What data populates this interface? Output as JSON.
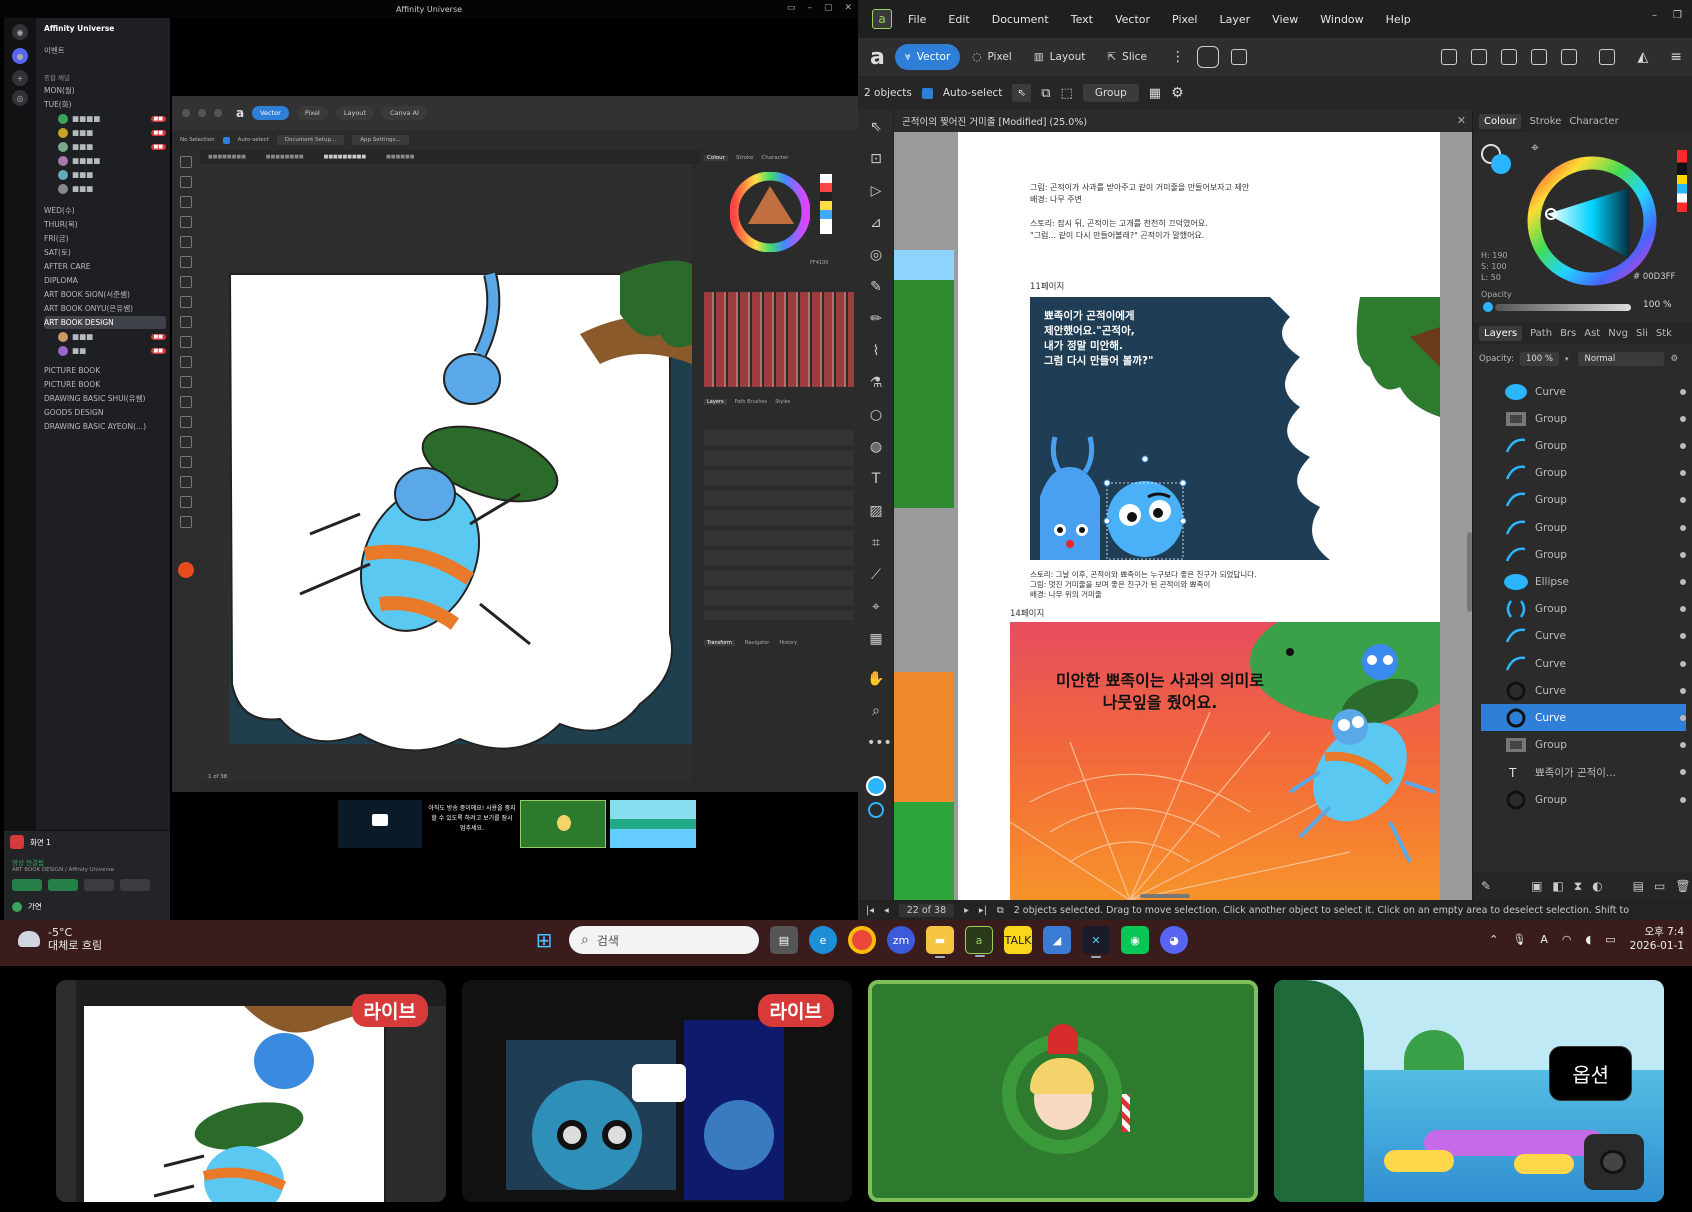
{
  "stream": {
    "title": "Affinity Universe",
    "discord": {
      "server_name": "Affinity Universe",
      "event_label": "이벤트",
      "category": "종합 채널",
      "channels": [
        {
          "label": "MON(월)"
        },
        {
          "label": "TUE(화)"
        },
        {
          "label": "WED(수)"
        },
        {
          "label": "THUR(목)"
        },
        {
          "label": "FRI(금)"
        },
        {
          "label": "SAT(토)"
        },
        {
          "label": "AFTER CARE"
        },
        {
          "label": "DIPLOMA"
        },
        {
          "label": "ART BOOK SION(서준쌤)"
        },
        {
          "label": "ART BOOK ONYU(은유쌤)"
        },
        {
          "label": "ART BOOK DESIGN"
        },
        {
          "label": "PICTURE BOOK"
        },
        {
          "label": "PICTURE BOOK"
        },
        {
          "label": "DRAWING BASIC SHUI(유쌤)"
        },
        {
          "label": "GOODS DESIGN"
        },
        {
          "label": "DRAWING BASIC AYEON(...)"
        }
      ],
      "voice_user": "화면 1",
      "voice_status": "영상 연결됨",
      "voice_channel": "ART BOOK DESIGN / Affinity Universe",
      "user_name": "가연"
    },
    "inner_app": {
      "tabs": [
        "Vector",
        "Pixel",
        "Layout",
        "Canva AI"
      ],
      "ctx": {
        "no_selection": "No Selection",
        "auto_select": "Auto-select",
        "doc_setup": "Document Setup...",
        "app_settings": "App Settings..."
      },
      "panel_tabs": [
        "Colour",
        "Stroke",
        "Character"
      ],
      "layers_tabs": [
        "Layers",
        "Path Brushes",
        "Styles"
      ],
      "transform_tabs": [
        "Transform",
        "Navigator",
        "History"
      ],
      "page_count": "1 of 38",
      "hex": "FF4100"
    },
    "stream_thumb_text": "아직도 방송 중이에요! 사용을 중지할 수 있도록 하려고 보기를 잠시 멈추세요."
  },
  "app": {
    "menu": [
      "File",
      "Edit",
      "Document",
      "Text",
      "Vector",
      "Pixel",
      "Layer",
      "View",
      "Window",
      "Help"
    ],
    "personas": [
      "Vector",
      "Pixel",
      "Layout",
      "Slice"
    ],
    "context": {
      "objects": "2 objects",
      "auto_select": "Auto-select",
      "group_btn": "Group"
    },
    "doc_title": "곤적이의 찢어진 거미줄 [Modified] (25.0%)",
    "doc_text": {
      "para1": "그림: 곤적이가 사과를 받아주고 같이 거미줄을 만들어보자고 제안",
      "para1b": "배경: 나무 주변",
      "para2": "스토리: 잠시 뒤, 곤적이는 고개를 천천히 끄덕였어요.",
      "para2b": "\"그럼... 같이 다시 만들어볼래?\" 곤적이가 말했어요.",
      "page11": "11페이지",
      "speech": [
        "뾰족이가 곤적이에게",
        "제안했어요.\"곤적아,",
        "내가 정말 미안해.",
        "그럼 다시 만들어 볼까?\""
      ],
      "para3": "스토리: 그날 이후, 곤적이와 뾰족이는 누구보다 좋은 친구가 되었답니다.",
      "para3b": "그림: 멋진 거미줄을 보며 좋은 친구가 된 곤적이와 뾰족이",
      "para3c": "배경: 나무 위의 거미줄",
      "page14": "14페이지",
      "big": [
        "미안한 뾰족이는 사과의 의미로",
        "나뭇잎을 줬어요."
      ]
    },
    "colour_panel": {
      "tabs": [
        "Colour",
        "Stroke",
        "Character"
      ],
      "h": "H: 190",
      "s": "S: 100",
      "l": "L: 50",
      "hex": "00D3FF",
      "opacity_label": "Opacity",
      "opacity_value": "100 %"
    },
    "layers_panel": {
      "tabs": [
        "Layers",
        "Path",
        "Brs",
        "Ast",
        "Nvg",
        "Sli",
        "Stk"
      ],
      "opacity_label": "Opacity:",
      "opacity_value": "100 %",
      "blend": "Normal",
      "items": [
        {
          "name": "Curve"
        },
        {
          "name": "Group"
        },
        {
          "name": "Group"
        },
        {
          "name": "Group"
        },
        {
          "name": "Group"
        },
        {
          "name": "Group"
        },
        {
          "name": "Group"
        },
        {
          "name": "Ellipse"
        },
        {
          "name": "Group"
        },
        {
          "name": "Curve"
        },
        {
          "name": "Curve"
        },
        {
          "name": "Curve"
        },
        {
          "name": "Curve"
        },
        {
          "name": "Group"
        },
        {
          "name": "뾰족이가 곤적이..."
        },
        {
          "name": "Group"
        }
      ]
    },
    "status": {
      "page": "22 of 38",
      "message": "2 objects selected. Drag to move selection. Click another object to select it. Click on an empty area to deselect selection. Shift to"
    }
  },
  "taskbar": {
    "weather_temp": "-5°C",
    "weather_desc": "대체로 흐림",
    "search_placeholder": "검색",
    "time": "오후 7:4",
    "date": "2026-01-1"
  },
  "previews": {
    "live_label": "라이브",
    "options_label": "옵션"
  },
  "colors": {
    "accent": "#2f7fd8",
    "brand": "#9ad15b",
    "live": "#d83a3a"
  }
}
